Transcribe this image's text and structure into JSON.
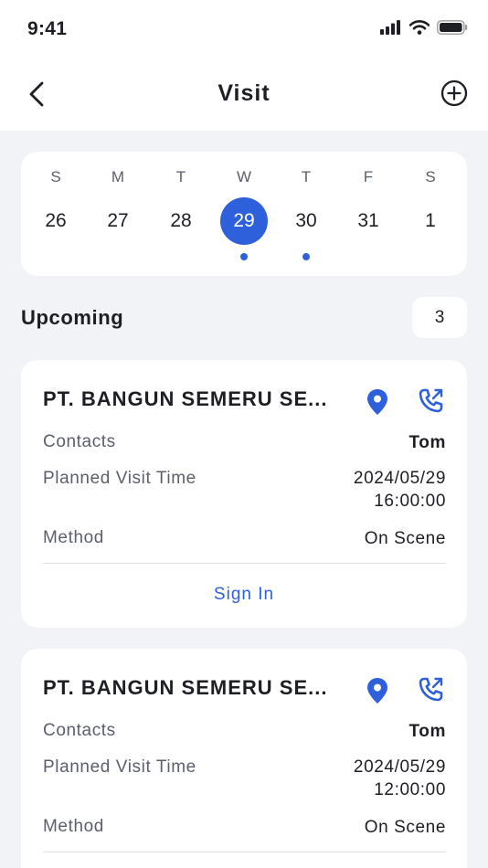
{
  "status_bar": {
    "time": "9:41"
  },
  "nav": {
    "title": "Visit"
  },
  "calendar": {
    "days": [
      {
        "weekday": "S",
        "date": "26",
        "selected": false,
        "has_event": false
      },
      {
        "weekday": "M",
        "date": "27",
        "selected": false,
        "has_event": false
      },
      {
        "weekday": "T",
        "date": "28",
        "selected": false,
        "has_event": false
      },
      {
        "weekday": "W",
        "date": "29",
        "selected": true,
        "has_event": true
      },
      {
        "weekday": "T",
        "date": "30",
        "selected": false,
        "has_event": true
      },
      {
        "weekday": "F",
        "date": "31",
        "selected": false,
        "has_event": false
      },
      {
        "weekday": "S",
        "date": "1",
        "selected": false,
        "has_event": false
      }
    ]
  },
  "upcoming": {
    "label": "Upcoming",
    "count": "3"
  },
  "visits": [
    {
      "company": "PT. BANGUN SEMERU SE...",
      "contacts_label": "Contacts",
      "contacts": "Tom",
      "time_label": "Planned Visit Time",
      "date": "2024/05/29",
      "time": "16:00:00",
      "method_label": "Method",
      "method": "On Scene",
      "action": "Sign In"
    },
    {
      "company": "PT. BANGUN SEMERU SE...",
      "contacts_label": "Contacts",
      "contacts": "Tom",
      "time_label": "Planned Visit Time",
      "date": "2024/05/29",
      "time": "12:00:00",
      "method_label": "Method",
      "method": "On Scene"
    }
  ],
  "icons": {
    "back": "chevron-left-icon",
    "add": "plus-circle-icon",
    "location": "location-pin-icon",
    "phone": "phone-outgoing-icon"
  },
  "colors": {
    "accent": "#2f60dc",
    "background": "#f2f3f7"
  }
}
